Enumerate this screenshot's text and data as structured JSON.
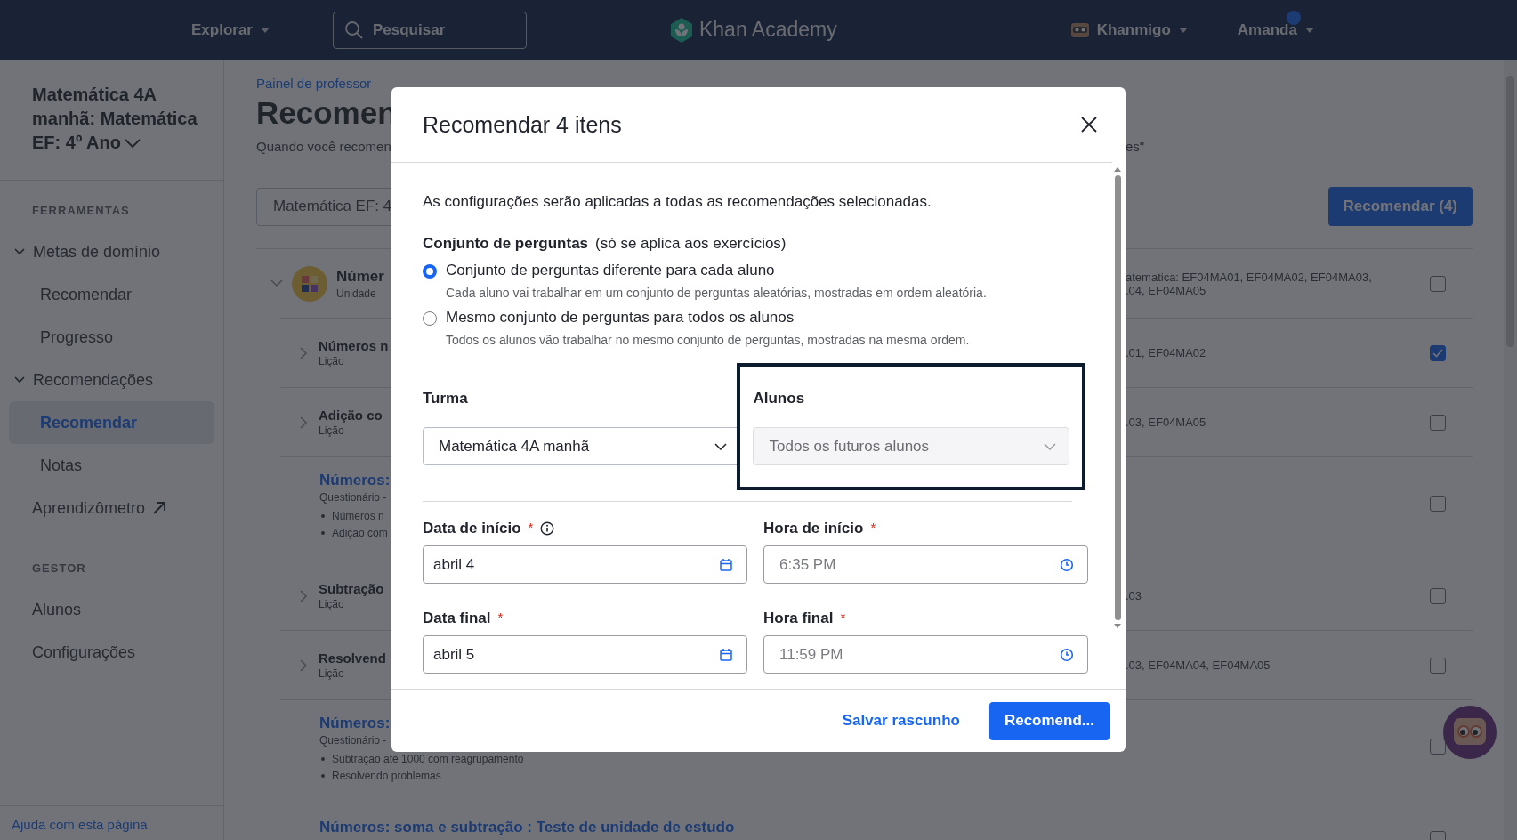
{
  "header": {
    "explore": "Explorar",
    "search": {
      "placeholder": "Pesquisar"
    },
    "logo": "Khan Academy",
    "assistant": "Khanmigo",
    "user": {
      "name": "Amanda",
      "notification": true
    }
  },
  "sidebar": {
    "class_title": "Matemática 4A manhã: Matemática EF: 4º Ano",
    "sections": [
      {
        "heading": "FERRAMENTAS",
        "items": [
          {
            "kind": "group",
            "label": "Metas de domínio",
            "expanded": true,
            "children": [
              {
                "label": "Recomendar",
                "selected": false
              },
              {
                "label": "Progresso",
                "selected": false
              }
            ]
          },
          {
            "kind": "group",
            "label": "Recomendações",
            "expanded": true,
            "children": [
              {
                "label": "Recomendar",
                "selected": true
              },
              {
                "label": "Notas",
                "selected": false
              }
            ]
          },
          {
            "kind": "external",
            "label": "Aprendizômetro",
            "selected": false
          }
        ]
      },
      {
        "heading": "GESTOR",
        "items": [
          {
            "kind": "link",
            "label": "Alunos",
            "selected": false
          },
          {
            "kind": "link",
            "label": "Configurações",
            "selected": false
          }
        ]
      }
    ],
    "help_link": "Ajuda com esta página"
  },
  "main": {
    "breadcrumb": "Painel de professor",
    "title": "Recomen",
    "subtitle_start": "Quando você recomen",
    "subtitle_end": "es\"",
    "course_select": "Matemática EF: 4",
    "recommend_button": "Recomendar (4)",
    "rows": [
      {
        "kind": "unit",
        "title": "Númer",
        "subtitle": "Unidade",
        "expanded": true,
        "standards": [
          "atematica: EF04MA01, EF04MA02, EF04MA03,",
          ".04, EF04MA05"
        ],
        "checked": false
      },
      {
        "kind": "lesson",
        "title": "Números n",
        "subtitle": "Lição",
        "standards": [
          ".01, EF04MA02"
        ],
        "checked": true
      },
      {
        "kind": "lesson",
        "title": "Adição co",
        "subtitle": "Lição",
        "standards": [
          ".03, EF04MA05"
        ],
        "checked": false
      },
      {
        "kind": "quiz",
        "title": "Números:",
        "subtitle": "Questionário -",
        "bullets": [
          "Números n",
          "Adição com"
        ],
        "checked": false
      },
      {
        "kind": "lesson",
        "title": "Subtração",
        "subtitle": "Lição",
        "standards": [
          ".03"
        ],
        "checked": false
      },
      {
        "kind": "lesson",
        "title": "Resolvend",
        "subtitle": "Lição",
        "standards": [
          ".03, EF04MA04, EF04MA05"
        ],
        "checked": false
      },
      {
        "kind": "quiz",
        "title": "Números:",
        "subtitle": "Questionário -",
        "bullets": [
          "Subtração até 1000 com reagrupamento",
          "Resolvendo problemas"
        ],
        "checked": false
      },
      {
        "kind": "quiz",
        "title": "Números: soma e subtração : Teste de unidade de estudo",
        "checked": false
      }
    ]
  },
  "modal": {
    "title": "Recomendar 4 itens",
    "intro": "As configurações serão aplicadas a todas as recomendações selecionadas.",
    "question_set": {
      "label": "Conjunto de perguntas",
      "note": "(só se aplica aos exercícios)",
      "options": [
        {
          "label": "Conjunto de perguntas diferente para cada aluno",
          "description": "Cada aluno vai trabalhar em um conjunto de perguntas aleatórias, mostradas em ordem aleatória.",
          "selected": true
        },
        {
          "label": "Mesmo conjunto de perguntas para todos os alunos",
          "description": "Todos os alunos vão trabalhar no mesmo conjunto de perguntas, mostradas na mesma ordem.",
          "selected": false
        }
      ]
    },
    "class_field": {
      "label": "Turma",
      "value": "Matemática 4A manhã",
      "disabled": false
    },
    "students_field": {
      "label": "Alunos",
      "value": "Todos os futuros alunos",
      "disabled": true,
      "highlighted": true
    },
    "schedule": [
      {
        "kind": "date",
        "label": "Data de início",
        "required_mark": "*",
        "info": true,
        "value": "abril 4"
      },
      {
        "kind": "time",
        "label": "Hora de início",
        "required_mark": "*",
        "placeholder": "6:35 PM"
      },
      {
        "kind": "date",
        "label": "Data final",
        "required_mark": "*",
        "value": "abril 5"
      },
      {
        "kind": "time",
        "label": "Hora final",
        "required_mark": "*",
        "placeholder": "11:59 PM"
      }
    ],
    "draft_link": "Salvar rascunho",
    "submit_button": "Recomend..."
  }
}
